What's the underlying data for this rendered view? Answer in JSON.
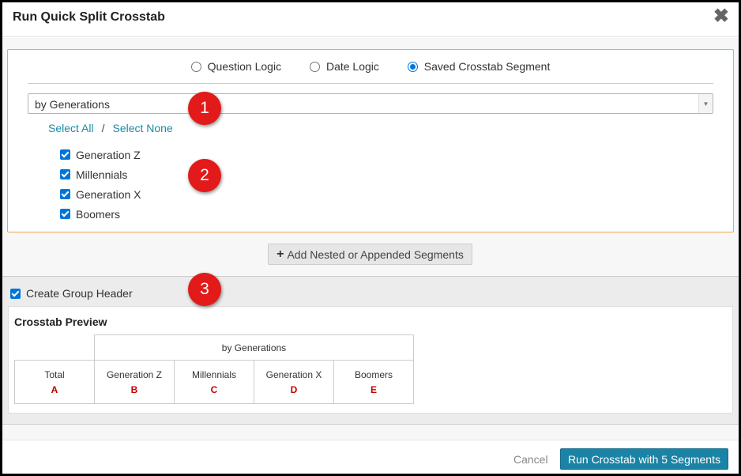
{
  "dialog": {
    "title": "Run Quick Split Crosstab",
    "close_glyph": "✖"
  },
  "logic_options": [
    {
      "label": "Question Logic",
      "checked": false
    },
    {
      "label": "Date Logic",
      "checked": false
    },
    {
      "label": "Saved Crosstab Segment",
      "checked": true
    }
  ],
  "segment_select": {
    "value": "by Generations"
  },
  "select_links": {
    "all": "Select All",
    "separator": "/",
    "none": "Select None"
  },
  "segments": [
    {
      "label": "Generation Z",
      "checked": true
    },
    {
      "label": "Millennials",
      "checked": true
    },
    {
      "label": "Generation X",
      "checked": true
    },
    {
      "label": "Boomers",
      "checked": true
    }
  ],
  "add_button": {
    "icon": "plus-icon",
    "label": "Add Nested or Appended Segments"
  },
  "group_header": {
    "label": "Create Group Header",
    "checked": true
  },
  "preview": {
    "title": "Crosstab Preview",
    "group_label": "by Generations",
    "total": {
      "label": "Total",
      "letter": "A"
    },
    "columns": [
      {
        "label": "Generation Z",
        "letter": "B"
      },
      {
        "label": "Millennials",
        "letter": "C"
      },
      {
        "label": "Generation X",
        "letter": "D"
      },
      {
        "label": "Boomers",
        "letter": "E"
      }
    ]
  },
  "annotations": [
    "1",
    "2",
    "3"
  ],
  "footer": {
    "cancel_label": "Cancel",
    "run_label": "Run Crosstab with 5 Segments"
  },
  "colors": {
    "accent": "#1b84a6",
    "panel_border": "#f0a54a",
    "badge": "#e21a1a",
    "letter": "#c00000"
  }
}
